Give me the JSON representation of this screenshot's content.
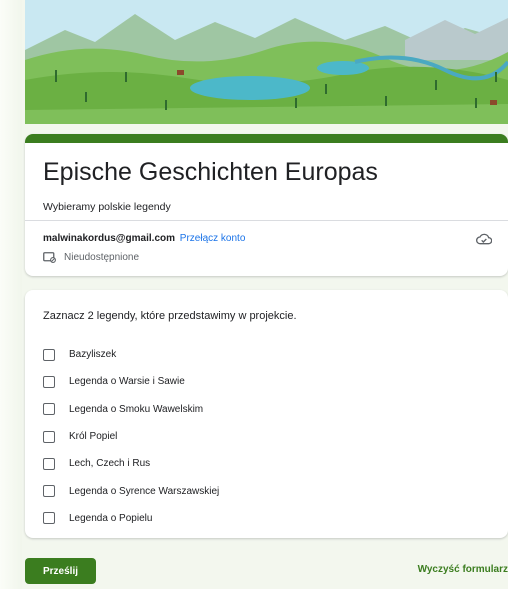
{
  "form": {
    "title": "Epische Geschichten Europas",
    "description": "Wybieramy polskie legendy",
    "account_email": "malwinakordus@gmail.com",
    "switch_account": "Przełącz konto",
    "not_shared": "Nieudostępnione"
  },
  "question": {
    "text": "Zaznacz 2 legendy, które przedstawimy w projekcie.",
    "options": [
      "Bazyliszek",
      "Legenda o Warsie i Sawie",
      "Legenda o Smoku Wawelskim",
      "Król Popiel",
      "Lech, Czech i Rus",
      "Legenda o Syrence Warszawskiej",
      "Legenda o Popielu"
    ]
  },
  "actions": {
    "submit": "Prześlij",
    "clear": "Wyczyść formularz"
  },
  "colors": {
    "accent": "#3b7d1f",
    "link": "#1a73e8"
  },
  "icons": {
    "cloud": "cloud-check-icon",
    "not_shared": "not-shared-icon",
    "checkbox": "checkbox-icon"
  }
}
